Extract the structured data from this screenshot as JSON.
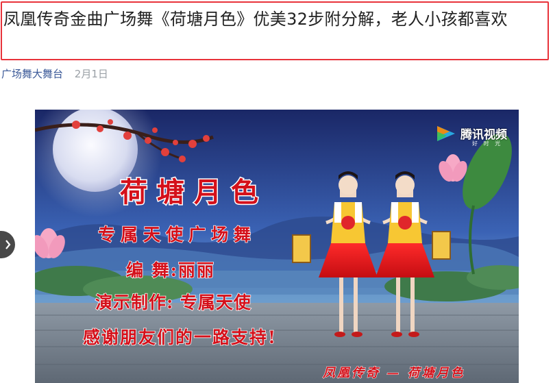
{
  "article": {
    "title": "凤凰传奇金曲广场舞《荷塘月色》优美32步附分解，老人小孩都喜欢",
    "author": "广场舞大舞台",
    "date": "2月1日"
  },
  "video": {
    "logo_text": "腾讯视频",
    "logo_sub": "好 时 光",
    "overlay": {
      "main_title": "荷塘月色",
      "line1": "专属天使广场舞",
      "line2": "编 舞:丽丽",
      "line3": "演示制作: 专属天使",
      "line4": "感谢朋友们的一路支持!",
      "subtitle": "凤凰传奇 — 荷塘月色"
    }
  },
  "nav": {
    "prev_icon": "chevron-left-icon"
  },
  "colors": {
    "highlight_border": "#e8323a",
    "author_link": "#3b5998",
    "overlay_text": "#d4101a"
  }
}
